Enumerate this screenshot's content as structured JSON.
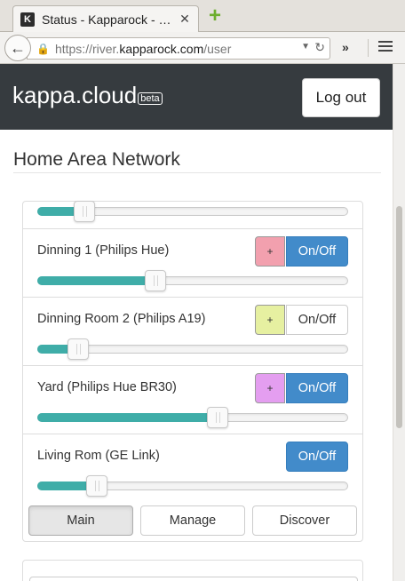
{
  "browser": {
    "tab_title": "Status - Kapparock - …",
    "favicon_letter": "K",
    "url_prefix": "https://river.",
    "url_domain": "kapparock.com",
    "url_path": "/user",
    "overflow_label": "»"
  },
  "header": {
    "brand": "kappa.cloud",
    "beta": "beta",
    "logout_label": "Log out"
  },
  "section": {
    "title": "Home Area Network"
  },
  "devices": [
    {
      "name": "",
      "level": 0.15
    },
    {
      "name": "Dinning 1 (Philips Hue)",
      "plus_label": "+",
      "color": "#f2a0ae",
      "onoff_label": "On/Off",
      "state": "on",
      "level": 0.38
    },
    {
      "name": "Dinning Room 2 (Philips A19)",
      "plus_label": "+",
      "color": "#e6f0a1",
      "onoff_label": "On/Off",
      "state": "off",
      "level": 0.13
    },
    {
      "name": "Yard (Philips Hue BR30)",
      "plus_label": "+",
      "color": "#e49ef0",
      "onoff_label": "On/Off",
      "state": "on",
      "level": 0.58
    },
    {
      "name": "Living Rom (GE Link)",
      "onoff_label": "On/Off",
      "state": "on",
      "level": 0.19
    }
  ],
  "tabs": [
    {
      "label": "Main",
      "active": true
    },
    {
      "label": "Manage",
      "active": false
    },
    {
      "label": "Discover",
      "active": false
    }
  ],
  "colors": {
    "accent": "#428bca",
    "slider_fill": "#3fada8",
    "header_bg": "#363b3f"
  }
}
